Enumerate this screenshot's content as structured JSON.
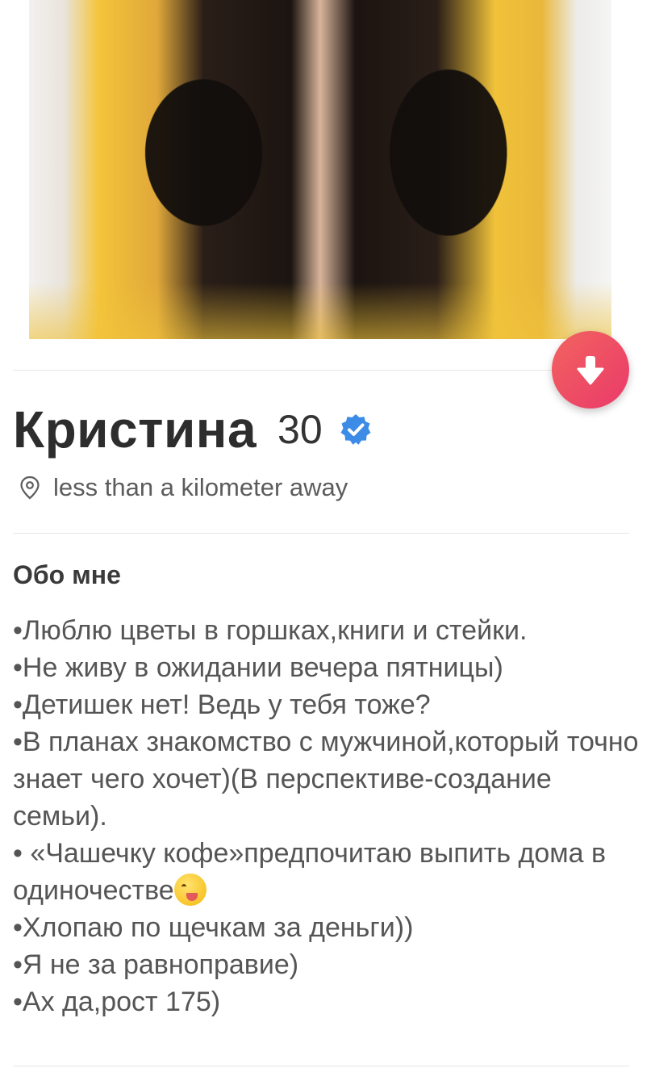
{
  "profile": {
    "name": "Кристина",
    "age": "30",
    "distance": "less than a kilometer away",
    "verified": true
  },
  "about": {
    "title": "Обо мне",
    "lines": [
      "•Люблю цветы в горшках,книги и стейки.",
      "•Не живу в ожидании вечера пятницы)",
      "•Детишек нет! Ведь у тебя тоже?",
      "•В планах знакомство с мужчиной,который точно знает чего хочет)(В перспективе-создание семьи).",
      "• «Чашечку кофе»предпочитаю выпить дома в одиночестве",
      "•Хлопаю по щечкам за деньги))",
      "•Я не за равноправие)",
      "•Ах да,рост 175)"
    ]
  },
  "icons": {
    "fab": "arrow-down-icon",
    "verified": "verified-badge-icon",
    "location": "location-pin-icon",
    "emoji": "yum-face-emoji"
  },
  "colors": {
    "fab_start": "#f2635f",
    "fab_end": "#ea3a6a",
    "verified_blue": "#3c8ce7"
  }
}
